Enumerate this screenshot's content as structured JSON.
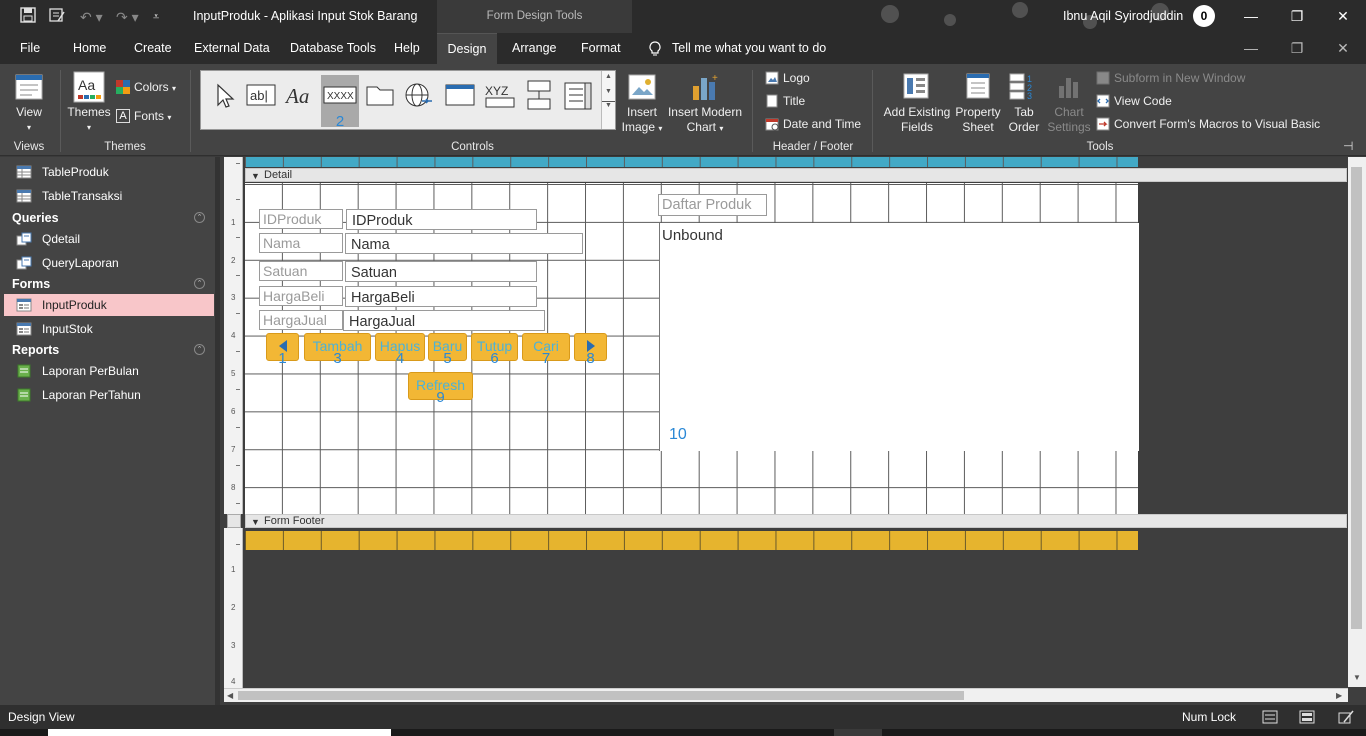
{
  "window": {
    "title": "InputProduk  -  Aplikasi Input Stok Barang",
    "context_tab_group": "Form Design Tools",
    "user_name": "Ibnu Aqil Syirodjuddin",
    "user_initial": "0"
  },
  "tabs": [
    "File",
    "Home",
    "Create",
    "External Data",
    "Database Tools",
    "Help",
    "Design",
    "Arrange",
    "Format"
  ],
  "active_tab": "Design",
  "tell_me": "Tell me what you want to do",
  "ribbon": {
    "views": {
      "label": "View",
      "group": "Views"
    },
    "themes": {
      "themes_label": "Themes",
      "colors_label": "Colors",
      "fonts_label": "Fonts",
      "group": "Themes"
    },
    "controls": {
      "group": "Controls",
      "label_text_sample": "Aa",
      "textbox_sample": "ab|",
      "button_sample": "XXXX",
      "button_number": "2",
      "xyz_sample": "XYZ"
    },
    "insert": {
      "image_label_1": "Insert",
      "image_label_2": "Image",
      "chart_label_1": "Insert Modern",
      "chart_label_2": "Chart"
    },
    "header_footer": {
      "logo": "Logo",
      "title": "Title",
      "date_time": "Date and Time",
      "group": "Header / Footer"
    },
    "tools": {
      "add_existing_1": "Add Existing",
      "add_existing_2": "Fields",
      "property_1": "Property",
      "property_2": "Sheet",
      "tab_order_1": "Tab",
      "tab_order_2": "Order",
      "chart_settings_1": "Chart",
      "chart_settings_2": "Settings",
      "subform_new_window": "Subform in New Window",
      "view_code": "View Code",
      "convert_macros": "Convert Form's Macros to Visual Basic",
      "group": "Tools"
    }
  },
  "nav": {
    "tables": [
      "TableProduk",
      "TableTransaksi"
    ],
    "queries_header": "Queries",
    "queries": [
      "Qdetail",
      "QueryLaporan"
    ],
    "forms_header": "Forms",
    "forms": [
      "InputProduk",
      "InputStok"
    ],
    "reports_header": "Reports",
    "reports": [
      "Laporan PerBulan",
      "Laporan PerTahun"
    ]
  },
  "design": {
    "detail_header": "Detail",
    "footer_header": "Form Footer",
    "fields": [
      {
        "label": "IDProduk",
        "textbox": "IDProduk"
      },
      {
        "label": "Nama",
        "textbox": "Nama"
      },
      {
        "label": "Satuan",
        "textbox": "Satuan"
      },
      {
        "label": "HargaBeli",
        "textbox": "HargaBeli"
      },
      {
        "label": "HargaJual",
        "textbox": "HargaJual"
      }
    ],
    "buttons": [
      {
        "text": "",
        "number": "1"
      },
      {
        "text": "Tambah",
        "number": "3"
      },
      {
        "text": "Hapus",
        "number": "4"
      },
      {
        "text": "Baru",
        "number": "5"
      },
      {
        "text": "Tutup",
        "number": "6"
      },
      {
        "text": "Cari",
        "number": "7"
      },
      {
        "text": "",
        "number": "8"
      },
      {
        "text": "Refresh",
        "number": "9"
      }
    ],
    "subform_label": "Daftar Produk",
    "subform_source": "Unbound",
    "subform_number": "10",
    "ruler_numbers": [
      "1",
      "2",
      "3",
      "4",
      "5",
      "6",
      "7",
      "8"
    ],
    "ruler_footer_numbers": [
      "1",
      "2",
      "3",
      "4"
    ]
  },
  "status": {
    "mode": "Design View",
    "num_lock": "Num Lock"
  },
  "colors": {
    "header_band": "#42a9c6",
    "footer_band": "#e6b42e",
    "button_fill": "#f2b735",
    "selected_nav": "#f8c6c9"
  }
}
